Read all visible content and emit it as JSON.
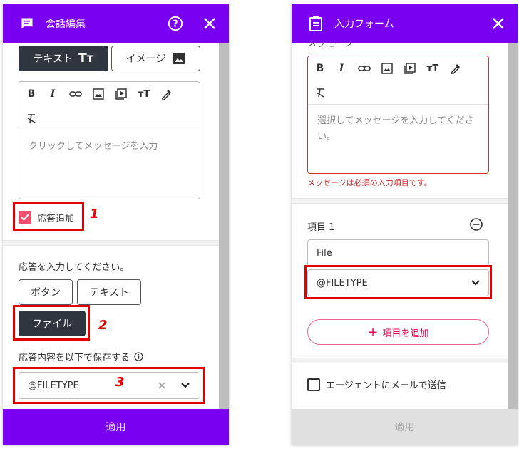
{
  "left_panel": {
    "title": "会話編集",
    "tabs": {
      "text_label": "テキスト",
      "text_icon": "Tт",
      "image_label": "イメージ"
    },
    "editor": {
      "placeholder": "クリックしてメッセージを入力"
    },
    "add_response_label": "応答追加",
    "response_prompt": "応答を入力してください。",
    "response_types": {
      "button": "ボタン",
      "text": "テキスト",
      "file": "ファイル"
    },
    "save_as_label": "応答内容を以下で保存する",
    "save_as_value": "@FILETYPE",
    "apply_label": "適用",
    "callouts": [
      "1",
      "2",
      "3"
    ],
    "colors": {
      "header": "#7a00f2",
      "active": "#2f3640",
      "checkbox": "#f0506e",
      "callout": "#e00000"
    }
  },
  "right_panel": {
    "title": "入力フォーム",
    "message_label": "メッセージ",
    "editor": {
      "placeholder": "選択してメッセージを入力してください。"
    },
    "error_text": "メッセージは必須の入力項目です。",
    "item_label": "項目 1",
    "item_name_value": "File",
    "item_type_value": "@FILETYPE",
    "add_item_label": "項目を追加",
    "add_item_icon": "+",
    "email_agent_label": "エージェントにメールで送信",
    "apply_label": "適用",
    "colors": {
      "error": "#d32f2f",
      "add_button": "#e8004f",
      "disabled_footer": "#e0e0e0"
    }
  }
}
